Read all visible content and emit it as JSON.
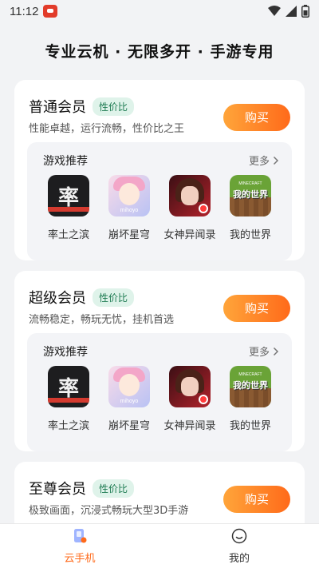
{
  "status_bar": {
    "time": "11:12"
  },
  "headline": "专业云机 · 无限多开 · 手游专用",
  "cards": [
    {
      "title": "普通会员",
      "badge": "性价比",
      "desc": "性能卓越，运行流畅，性价比之王",
      "buy_label": "购买",
      "rec_title": "游戏推荐",
      "more_label": "更多",
      "games": [
        "率土之滨",
        "崩坏星穹",
        "女神异闻录",
        "我的世界"
      ]
    },
    {
      "title": "超级会员",
      "badge": "性价比",
      "desc": "流畅稳定，畅玩无忧，挂机首选",
      "buy_label": "购买",
      "rec_title": "游戏推荐",
      "more_label": "更多",
      "games": [
        "率土之滨",
        "崩坏星穹",
        "女神异闻录",
        "我的世界"
      ]
    },
    {
      "title": "至尊会员",
      "badge": "性价比",
      "desc": "极致画面，沉浸式畅玩大型3D手游",
      "buy_label": "购买"
    }
  ],
  "game_icon_text": {
    "lts_glyph": "率",
    "hsr_tag": "mihoyo",
    "mc_sub": "MINECRAFT",
    "mc_logo": "我的世界"
  },
  "tabs": [
    {
      "label": "云手机",
      "active": true
    },
    {
      "label": "我的",
      "active": false
    }
  ],
  "colors": {
    "accent": "#ff6a1a",
    "badge_bg": "#dff3ea",
    "badge_text": "#1e7b52"
  }
}
